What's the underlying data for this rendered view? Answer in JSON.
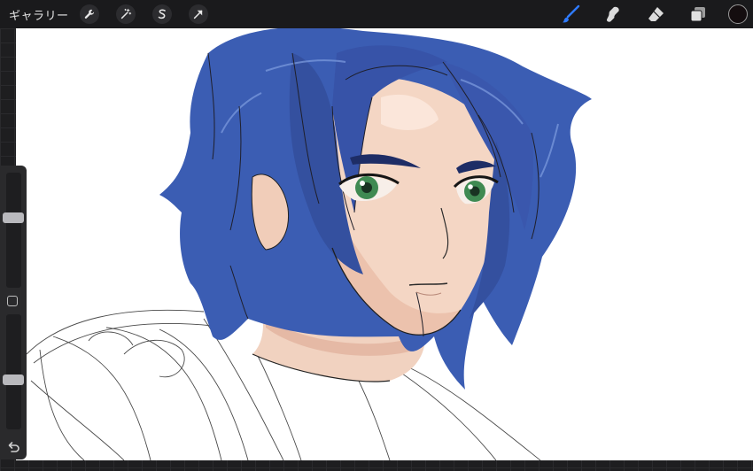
{
  "topbar": {
    "gallery_label": "ギャラリー",
    "left_tools": [
      {
        "icon": "wrench-icon",
        "name": "actions"
      },
      {
        "icon": "magic-wand-icon",
        "name": "adjustments"
      },
      {
        "icon": "selection-s-icon",
        "name": "selection"
      },
      {
        "icon": "arrow-cursor-icon",
        "name": "transform"
      }
    ],
    "right_tools": [
      {
        "icon": "brush-icon",
        "name": "paint",
        "active": true
      },
      {
        "icon": "smudge-icon",
        "name": "smudge"
      },
      {
        "icon": "eraser-icon",
        "name": "eraser"
      },
      {
        "icon": "layers-icon",
        "name": "layers"
      }
    ],
    "current_color": "#140d0f"
  },
  "colors": {
    "accent": "#2f7bff",
    "hair": "#3b5db3",
    "skin": "#f4d6c4",
    "eyes": "#3f8a52"
  },
  "sidebar": {
    "brush_size_level": 0.62,
    "opacity_level": 0.42,
    "modify_icon": "square-icon",
    "undo_icon": "undo-icon"
  }
}
